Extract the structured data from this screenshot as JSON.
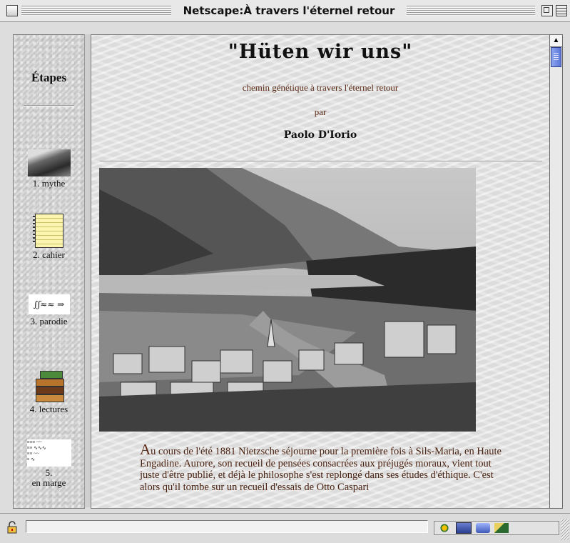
{
  "window": {
    "title": "Netscape:À travers l'éternel retour"
  },
  "sidebar": {
    "heading": "Étapes",
    "items": [
      {
        "label": "1. mythe",
        "icon": "mountain-photo-icon"
      },
      {
        "label": "2. cahier",
        "icon": "notebook-icon"
      },
      {
        "label": "3. parodie",
        "icon": "manuscript-icon"
      },
      {
        "label": "4. lectures",
        "icon": "books-stack-icon"
      },
      {
        "label_line1": "5.",
        "label_line2": "en marge",
        "icon": "margin-notes-icon"
      }
    ]
  },
  "main": {
    "title": "\"Hüten wir uns\"",
    "subtitle": "chemin génétique à travers l'éternel retour",
    "by": "par",
    "author": "Paolo D'Iorio",
    "image_alt": "Sils-Maria, Haute Engadine",
    "body_dropcap": "A",
    "body_text": "u cours de l'été 1881 Nietzsche séjourne pour la première fois à Sils-Maria, en Haute Engadine. Aurore, son recueil de pensées consacrées aux préjugés moraux, vient tout juste d'être publié, et déjà le philosophe s'est replongé dans ses études d'éthique. C'est alors qu'il tombe sur un recueil d'essais de Otto Caspari"
  },
  "colors": {
    "accent_text": "#5a2a14",
    "scroll_thumb": "#6f87e0"
  }
}
